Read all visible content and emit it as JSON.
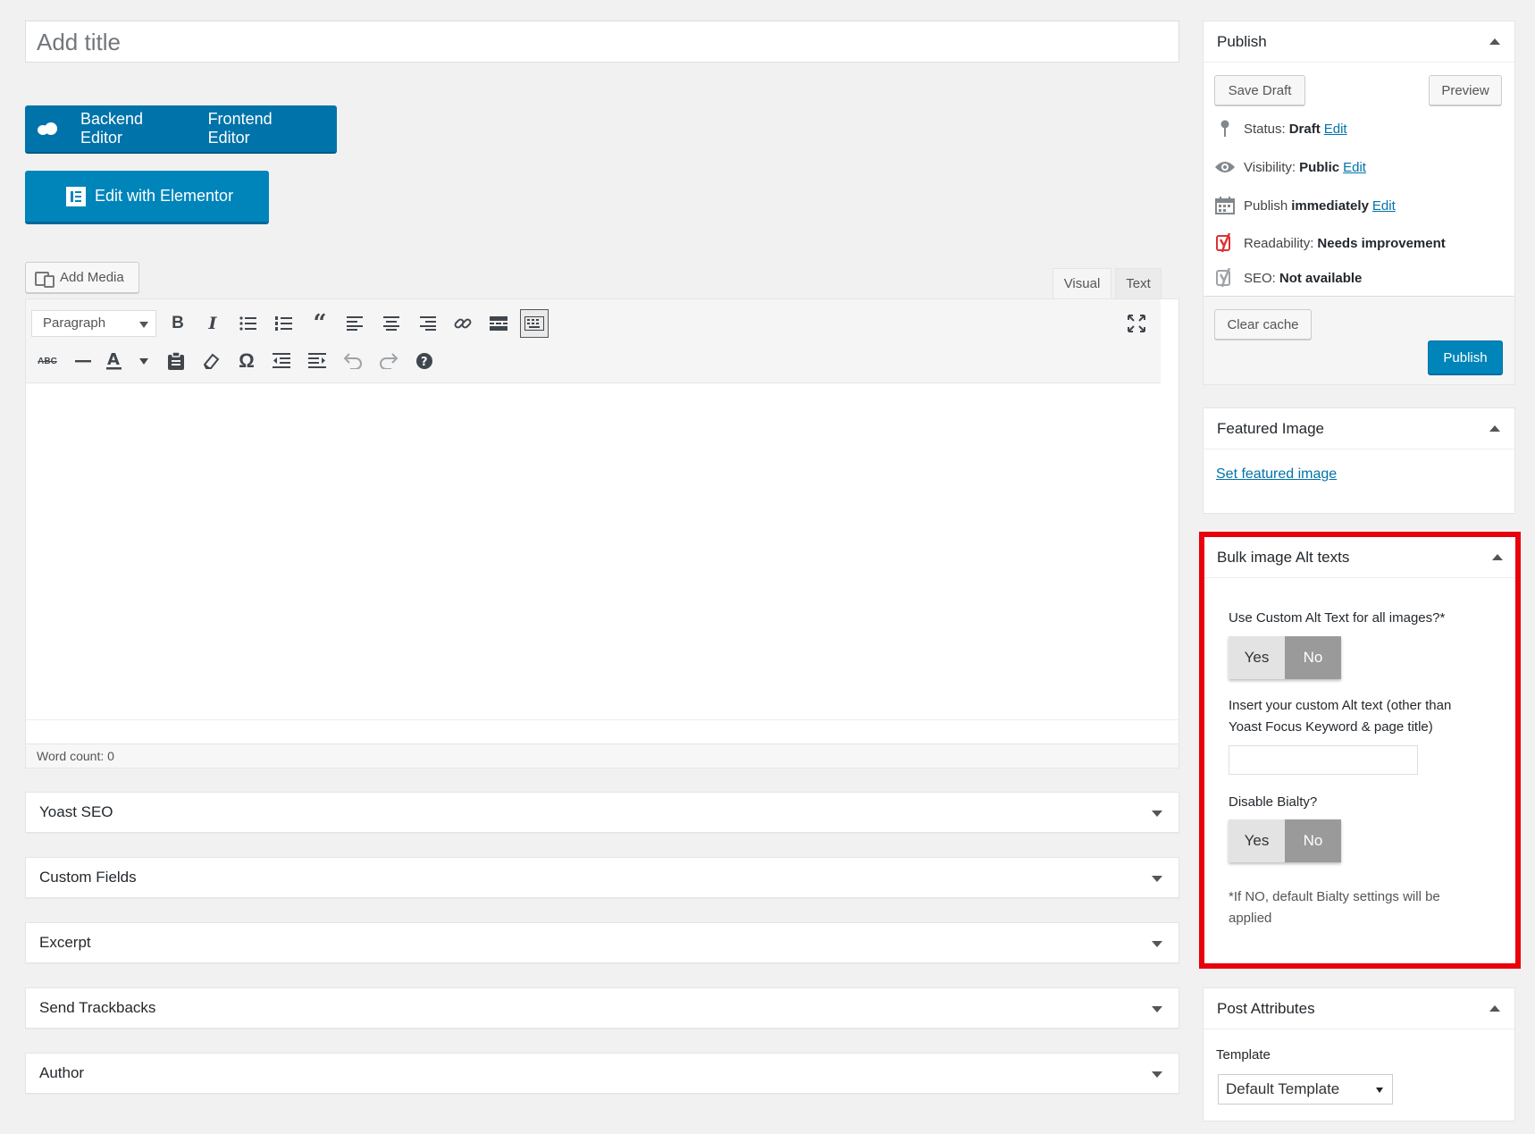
{
  "title_placeholder": "Add title",
  "builder": {
    "backend_label": "Backend Editor",
    "frontend_label": "Frontend Editor",
    "elementor_label": "Edit with Elementor"
  },
  "media": {
    "add_media_label": "Add Media"
  },
  "editor_tabs": {
    "visual": "Visual",
    "text": "Text"
  },
  "toolbar": {
    "format_select": "Paragraph",
    "row1": [
      "bold-icon",
      "italic-icon",
      "bullet-list-icon",
      "numbered-list-icon",
      "blockquote-icon",
      "align-left-icon",
      "align-center-icon",
      "align-right-icon",
      "link-icon",
      "read-more-icon",
      "toolbar-toggle-icon"
    ],
    "row2": [
      "strikethrough-icon",
      "horizontal-line-icon",
      "text-color-icon",
      "paste-text-icon",
      "clear-formatting-icon",
      "special-character-icon",
      "outdent-icon",
      "indent-icon",
      "undo-icon",
      "redo-icon",
      "help-icon"
    ]
  },
  "word_count": "Word count: 0",
  "metaboxes": [
    "Yoast SEO",
    "Custom Fields",
    "Excerpt",
    "Send Trackbacks",
    "Author"
  ],
  "publish": {
    "title": "Publish",
    "save_draft": "Save Draft",
    "preview": "Preview",
    "status_label": "Status:",
    "status_value": "Draft",
    "visibility_label": "Visibility:",
    "visibility_value": "Public",
    "publish_label": "Publish",
    "publish_value": "immediately",
    "edit_link": "Edit",
    "readability_label": "Readability:",
    "readability_value": "Needs improvement",
    "seo_label": "SEO:",
    "seo_value": "Not available",
    "clear_cache": "Clear cache",
    "publish_button": "Publish"
  },
  "featured_image": {
    "title": "Featured Image",
    "link": "Set featured image"
  },
  "bulk_alt": {
    "title": "Bulk image Alt texts",
    "q1": "Use Custom Alt Text for all images?*",
    "yes": "Yes",
    "no": "No",
    "q2_line1": "Insert your custom Alt text (other than",
    "q2_line2": "Yoast Focus Keyword & page title)",
    "q3": "Disable Bialty?",
    "note_line1": "*If NO, default Bialty settings will be",
    "note_line2": "applied"
  },
  "post_attributes": {
    "title": "Post Attributes",
    "template_label": "Template",
    "template_value": "Default Template"
  },
  "colors": {
    "primary": "#0085ba",
    "highlight": "#e8000b",
    "yoast_red": "#dc3232"
  }
}
